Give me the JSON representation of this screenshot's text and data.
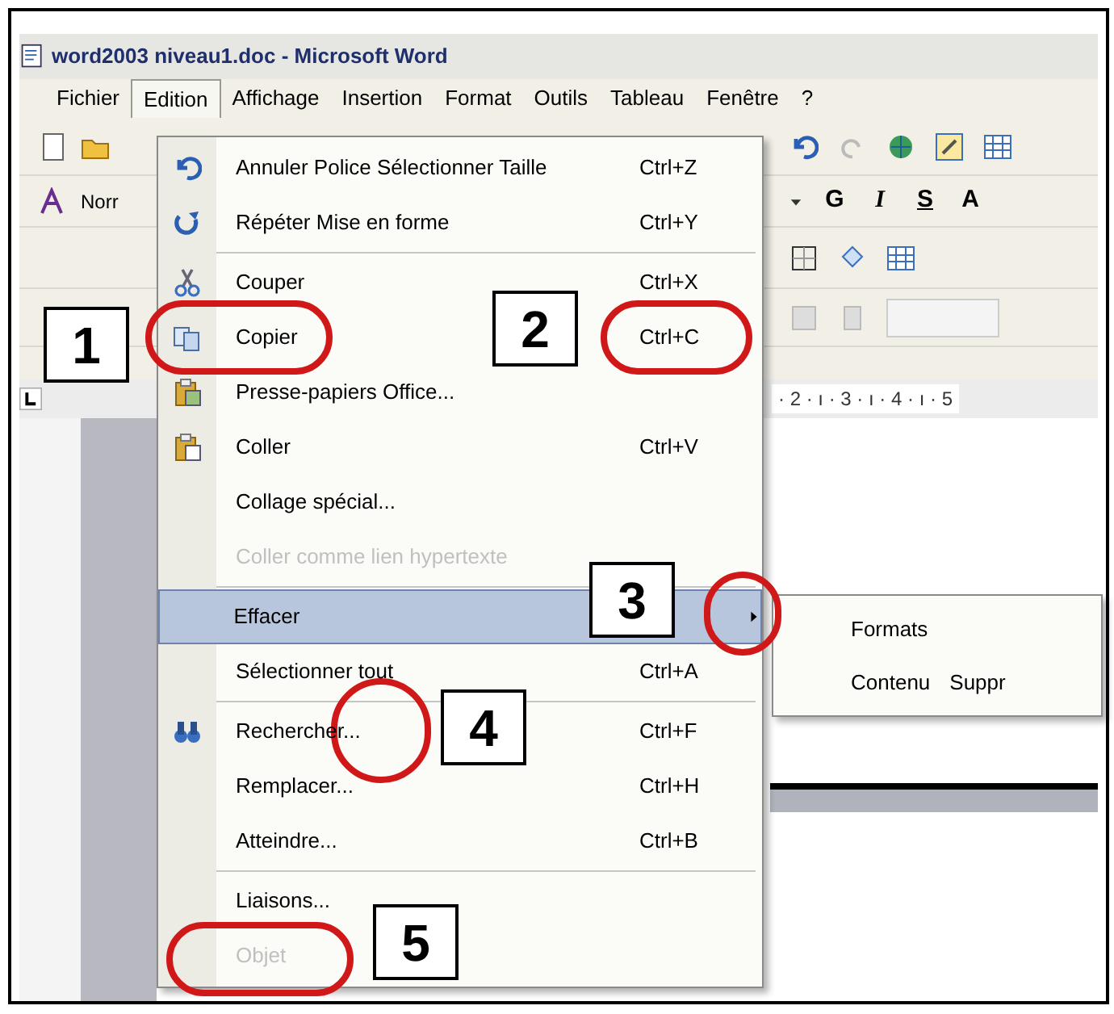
{
  "window": {
    "title": "word2003 niveau1.doc - Microsoft Word"
  },
  "menubar": [
    {
      "label": "Fichier",
      "selected": false
    },
    {
      "label": "Edition",
      "selected": true
    },
    {
      "label": "Affichage",
      "selected": false
    },
    {
      "label": "Insertion",
      "selected": false
    },
    {
      "label": "Format",
      "selected": false
    },
    {
      "label": "Outils",
      "selected": false
    },
    {
      "label": "Tableau",
      "selected": false
    },
    {
      "label": "Fenêtre",
      "selected": false
    },
    {
      "label": "?",
      "selected": false
    }
  ],
  "toolbar": {
    "style_box": "Norr",
    "format_buttons": [
      "G",
      "I",
      "S",
      "A"
    ]
  },
  "ruler": {
    "marks": "· 2 · ı · 3 · ı · 4 · ı · 5"
  },
  "menu": {
    "items": [
      {
        "kind": "item",
        "label": "Annuler Police Sélectionner Taille",
        "shortcut": "Ctrl+Z",
        "disabled": false,
        "selected": false
      },
      {
        "kind": "item",
        "label": "Répéter Mise en forme",
        "shortcut": "Ctrl+Y",
        "disabled": false,
        "selected": false
      },
      {
        "kind": "separator"
      },
      {
        "kind": "item",
        "label": "Couper",
        "shortcut": "Ctrl+X",
        "disabled": false,
        "selected": false
      },
      {
        "kind": "item",
        "label": "Copier",
        "shortcut": "Ctrl+C",
        "disabled": false,
        "selected": false
      },
      {
        "kind": "item",
        "label": "Presse-papiers Office...",
        "disabled": false,
        "selected": false
      },
      {
        "kind": "item",
        "label": "Coller",
        "shortcut": "Ctrl+V",
        "disabled": false,
        "selected": false
      },
      {
        "kind": "item",
        "label": "Collage spécial...",
        "disabled": false,
        "selected": false
      },
      {
        "kind": "item",
        "label": "Coller comme lien hypertexte",
        "disabled": true,
        "selected": false
      },
      {
        "kind": "separator"
      },
      {
        "kind": "submenu",
        "label": "Effacer",
        "disabled": false,
        "selected": true
      },
      {
        "kind": "item",
        "label": "Sélectionner tout",
        "shortcut": "Ctrl+A",
        "disabled": false,
        "selected": false
      },
      {
        "kind": "separator"
      },
      {
        "kind": "item",
        "label": "Rechercher...",
        "shortcut": "Ctrl+F",
        "disabled": false,
        "selected": false
      },
      {
        "kind": "item",
        "label": "Remplacer...",
        "shortcut": "Ctrl+H",
        "disabled": false,
        "selected": false
      },
      {
        "kind": "item",
        "label": "Atteindre...",
        "shortcut": "Ctrl+B",
        "disabled": false,
        "selected": false
      },
      {
        "kind": "separator"
      },
      {
        "kind": "item",
        "label": "Liaisons...",
        "disabled": false,
        "selected": false
      },
      {
        "kind": "item",
        "label": "Objet",
        "disabled": true,
        "selected": false
      }
    ]
  },
  "submenu": {
    "items": [
      {
        "label": "Formats"
      },
      {
        "label": "Contenu",
        "shortcut": "Suppr"
      }
    ]
  },
  "callouts": [
    {
      "label": "1"
    },
    {
      "label": "2"
    },
    {
      "label": "3"
    },
    {
      "label": "4"
    },
    {
      "label": "5"
    }
  ]
}
